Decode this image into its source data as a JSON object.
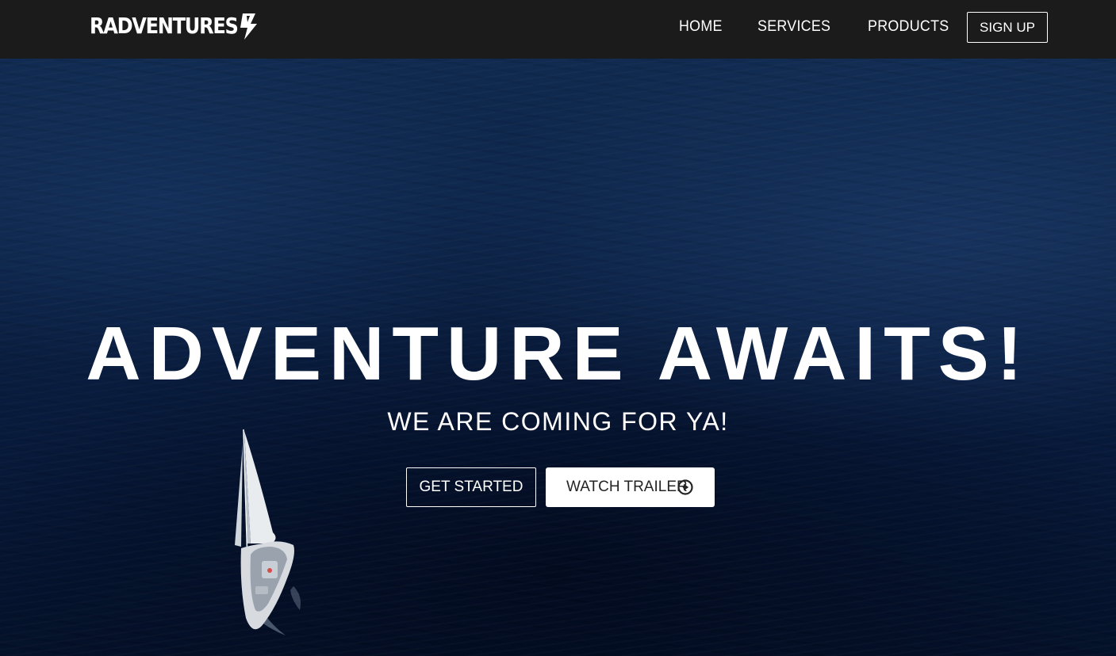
{
  "navbar": {
    "logo_text": "RADVENTURES",
    "logo_icon": "lightning-bolt-icon",
    "links": [
      {
        "label": "HOME"
      },
      {
        "label": "SERVICES"
      },
      {
        "label": "PRODUCTS"
      }
    ],
    "signup_label": "SIGN UP"
  },
  "hero": {
    "title": "ADVENTURE AWAITS!",
    "subtitle": "WE ARE COMING FOR YA!",
    "primary_button_label": "GET STARTED",
    "secondary_button_label": "WATCH TRAILER",
    "secondary_button_icon": "play-circle-icon",
    "background": "ocean with sailboat"
  },
  "colors": {
    "navbar_bg": "#1c1b1b",
    "text": "#ffffff",
    "ocean_dark": "#061634",
    "ocean_mid": "#0f2a55",
    "button_secondary_bg": "#ffffff",
    "button_secondary_text": "#242424"
  }
}
